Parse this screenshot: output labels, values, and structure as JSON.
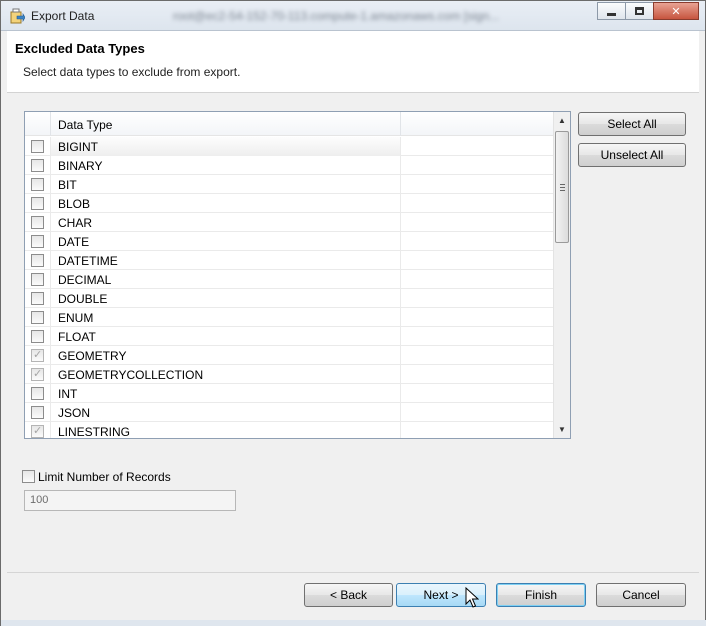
{
  "window": {
    "title": "Export Data",
    "host": "root@ec2-54-152-70-113.compute-1.amazonaws.com [sign..."
  },
  "header": {
    "title": "Excluded Data Types",
    "description": "Select data types to exclude from export."
  },
  "table": {
    "column_header": "Data Type",
    "rows": [
      {
        "label": "BIGINT",
        "checked": false
      },
      {
        "label": "BINARY",
        "checked": false
      },
      {
        "label": "BIT",
        "checked": false
      },
      {
        "label": "BLOB",
        "checked": false
      },
      {
        "label": "CHAR",
        "checked": false
      },
      {
        "label": "DATE",
        "checked": false
      },
      {
        "label": "DATETIME",
        "checked": false
      },
      {
        "label": "DECIMAL",
        "checked": false
      },
      {
        "label": "DOUBLE",
        "checked": false
      },
      {
        "label": "ENUM",
        "checked": false
      },
      {
        "label": "FLOAT",
        "checked": false
      },
      {
        "label": "GEOMETRY",
        "checked": true
      },
      {
        "label": "GEOMETRYCOLLECTION",
        "checked": true
      },
      {
        "label": "INT",
        "checked": false
      },
      {
        "label": "JSON",
        "checked": false
      },
      {
        "label": "LINESTRING",
        "checked": true
      }
    ]
  },
  "buttons": {
    "select_all": "Select All",
    "unselect_all": "Unselect All",
    "back": "< Back",
    "next": "Next >",
    "finish": "Finish",
    "cancel": "Cancel"
  },
  "limit": {
    "label": "Limit Number of Records",
    "checked": false,
    "value": "100"
  }
}
